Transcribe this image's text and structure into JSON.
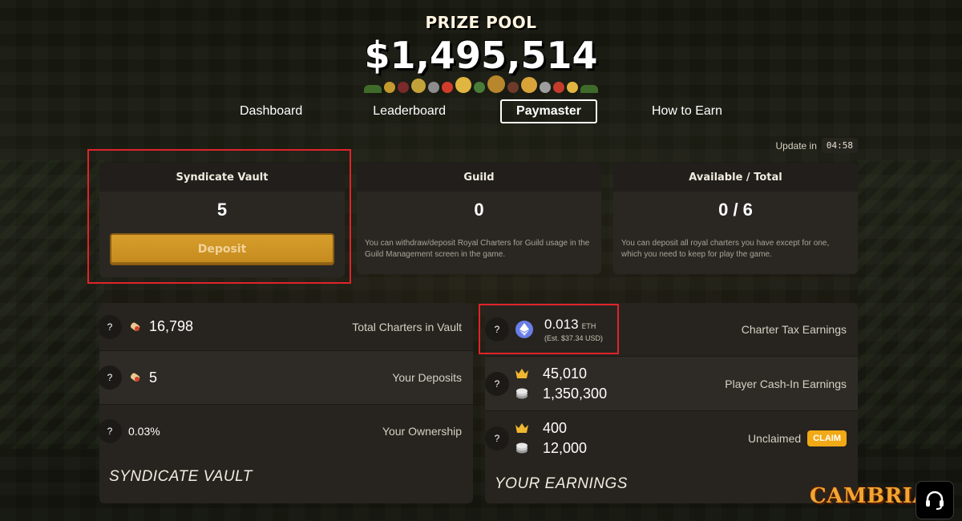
{
  "header": {
    "prize_label": "PRIZE POOL",
    "prize_amount": "$1,495,514"
  },
  "nav": {
    "items": [
      {
        "label": "Dashboard",
        "active": false
      },
      {
        "label": "Leaderboard",
        "active": false
      },
      {
        "label": "Paymaster",
        "active": true
      },
      {
        "label": "How to Earn",
        "active": false
      }
    ]
  },
  "update": {
    "label": "Update in",
    "timer": "04:58"
  },
  "cards": {
    "syndicate_vault": {
      "title": "Syndicate Vault",
      "value": "5",
      "button_label": "Deposit"
    },
    "guild": {
      "title": "Guild",
      "value": "0",
      "note": "You can withdraw/deposit Royal Charters for Guild usage in the Guild Management screen in the game."
    },
    "available_total": {
      "title": "Available / Total",
      "value": "0 / 6",
      "note": "You can deposit all royal charters you have except for one, which you need to keep for play the game."
    }
  },
  "vault_panel": {
    "title": "SYNDICATE VAULT",
    "rows": [
      {
        "help": "?",
        "value": "16,798",
        "label": "Total Charters in Vault",
        "icon": "charter-icon"
      },
      {
        "help": "?",
        "value": "5",
        "label": "Your Deposits",
        "icon": "charter-icon"
      },
      {
        "help": "?",
        "value": "0.03%",
        "label": "Your Ownership"
      }
    ]
  },
  "earnings_panel": {
    "title": "YOUR EARNINGS",
    "rows": [
      {
        "help": "?",
        "amount": "0.013",
        "unit": "ETH",
        "estimate": "(Est. $37.34 USD)",
        "label": "Charter Tax Earnings",
        "icon": "eth-icon"
      },
      {
        "help": "?",
        "crown_value": "45,010",
        "silver_value": "1,350,300",
        "label": "Player Cash-In Earnings"
      },
      {
        "help": "?",
        "crown_value": "400",
        "silver_value": "12,000",
        "label": "Unclaimed",
        "claim_label": "CLAIM"
      }
    ]
  },
  "logo": "CAMBRIA",
  "colors": {
    "accent_gold": "#d79e2c",
    "claim_orange": "#f2a916",
    "highlight_red": "#e1232b",
    "eth_blue": "#6a7ee8"
  }
}
